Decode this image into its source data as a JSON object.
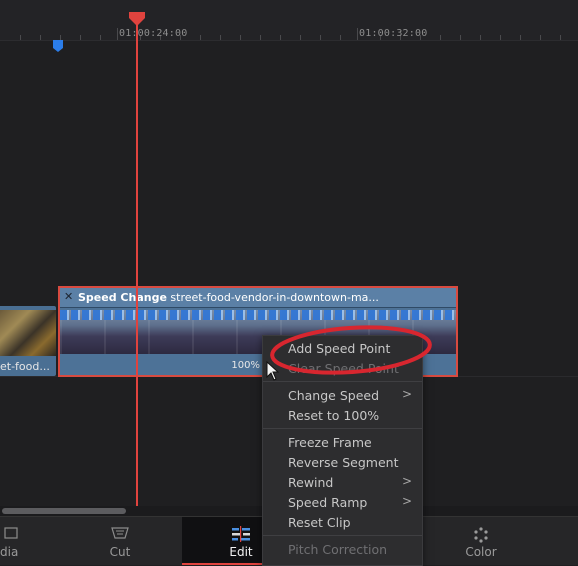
{
  "ruler": {
    "timecodes": [
      "01:00:24:00",
      "01:00:32:00"
    ]
  },
  "timeline": {
    "left_clip_name": "et-food...",
    "main_clip": {
      "effect_label": "Speed Change",
      "clip_name": "street-food-vendor-in-downtown-ma...",
      "speed_percent": "100%"
    }
  },
  "context_menu": {
    "items": [
      {
        "label": "Add Speed Point",
        "enabled": true
      },
      {
        "label": "Clear Speed Point",
        "enabled": false
      },
      {
        "label": "Change Speed",
        "enabled": true,
        "submenu": true
      },
      {
        "label": "Reset to 100%",
        "enabled": true
      },
      {
        "label": "Freeze Frame",
        "enabled": true
      },
      {
        "label": "Reverse Segment",
        "enabled": true
      },
      {
        "label": "Rewind",
        "enabled": true,
        "submenu": true
      },
      {
        "label": "Speed Ramp",
        "enabled": true,
        "submenu": true
      },
      {
        "label": "Reset Clip",
        "enabled": true
      },
      {
        "label": "Pitch Correction",
        "enabled": false
      }
    ],
    "chevron": ">"
  },
  "page_tabs": [
    {
      "label": "dia"
    },
    {
      "label": "Cut"
    },
    {
      "label": "Edit",
      "active": true
    },
    {
      "label": "Color"
    }
  ],
  "colors": {
    "playhead": "#e0433e",
    "clip_blue": "#4d7297",
    "highlight_red": "#d8262f",
    "marker_blue": "#2b7de9"
  }
}
